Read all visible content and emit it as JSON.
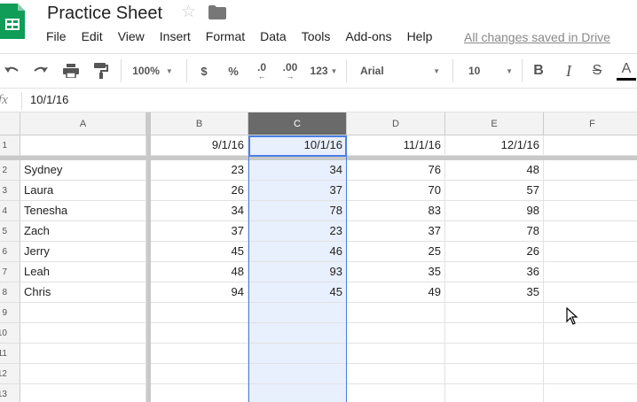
{
  "app": {
    "title": "Practice Sheet",
    "save_status": "All changes saved in Drive",
    "icons": [
      "sheets-logo-icon",
      "star-icon",
      "folder-icon"
    ]
  },
  "menu": [
    "File",
    "Edit",
    "View",
    "Insert",
    "Format",
    "Data",
    "Tools",
    "Add-ons",
    "Help"
  ],
  "toolbar": {
    "zoom": "100%",
    "currency": "$",
    "percent": "%",
    "decrease_decimals": ".0",
    "increase_decimals": ".00",
    "more_formats": "123",
    "font": "Arial",
    "font_size": "10",
    "bold": "B",
    "italic": "I",
    "strikethrough": "S",
    "text_color": "A"
  },
  "formula_bar": {
    "fx": "fx",
    "value": "10/1/16"
  },
  "grid": {
    "columns": [
      "A",
      "B",
      "C",
      "D",
      "E",
      "F"
    ],
    "selected_column": "C",
    "header_row": [
      "",
      "9/1/16",
      "10/1/16",
      "11/1/16",
      "12/1/16",
      ""
    ],
    "rows": [
      [
        "Sydney",
        "23",
        "34",
        "76",
        "48",
        ""
      ],
      [
        "Laura",
        "26",
        "37",
        "70",
        "57",
        ""
      ],
      [
        "Tenesha",
        "34",
        "78",
        "83",
        "98",
        ""
      ],
      [
        "Zach",
        "37",
        "23",
        "37",
        "78",
        ""
      ],
      [
        "Jerry",
        "45",
        "46",
        "25",
        "26",
        ""
      ],
      [
        "Leah",
        "48",
        "93",
        "35",
        "36",
        ""
      ],
      [
        "Chris",
        "94",
        "45",
        "49",
        "35",
        ""
      ],
      [
        "",
        "",
        "",
        "",
        "",
        ""
      ],
      [
        "",
        "",
        "",
        "",
        "",
        ""
      ],
      [
        "",
        "",
        "",
        "",
        "",
        ""
      ],
      [
        "",
        "",
        "",
        "",
        "",
        ""
      ],
      [
        "",
        "",
        "",
        "",
        "",
        ""
      ]
    ],
    "row_numbers": [
      "1",
      "2",
      "3",
      "4",
      "5",
      "6",
      "7",
      "8",
      "9",
      "10",
      "11",
      "12",
      "13"
    ]
  },
  "colors": {
    "sheets_green": "#0f9d58",
    "selection_blue": "#4a7fe3",
    "selection_fill": "#e8effd",
    "header_selected": "#6a6a6a"
  }
}
